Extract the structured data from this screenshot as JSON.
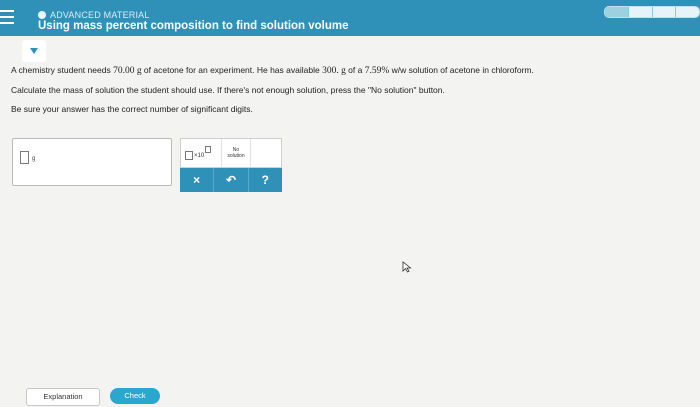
{
  "header": {
    "topic": "ADVANCED MATERIAL",
    "title": "Using mass percent composition to find solution volume",
    "progress": {
      "segments": 4,
      "filled": 1
    }
  },
  "problem": {
    "line1_pre": "A chemistry student needs ",
    "line1_mass": "70.00 g",
    "line1_mid": " of acetone for an experiment. He has available ",
    "line1_avail": "300. g",
    "line1_mid2": " of a ",
    "line1_pct": "7.59%",
    "line1_post": " w/w solution of acetone in chloroform.",
    "line2": "Calculate the mass of solution the student should use. If there's not enough solution, press the \"No solution\" button.",
    "line3": "Be sure your answer has the correct number of significant digits."
  },
  "answer": {
    "unit": "g",
    "value": ""
  },
  "tools": {
    "sci_label": "×10",
    "no_solution_line1": "No",
    "no_solution_line2": "solution",
    "clear_label": "×",
    "undo_label": "↶",
    "help_label": "?"
  },
  "footer": {
    "explanation_label": "Explanation",
    "check_label": "Check"
  },
  "colors": {
    "accent": "#2f90b8",
    "check": "#2aa7cf"
  }
}
